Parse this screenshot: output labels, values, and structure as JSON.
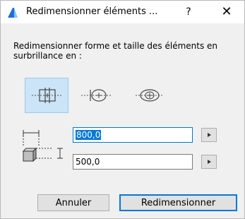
{
  "window": {
    "title": "Redimensionner éléments ...",
    "help_label": "?",
    "close_label": "✕"
  },
  "prompt": "Redimensionner forme et taille des éléments en surbrillance en :",
  "modes": [
    {
      "name": "resize-mode-rectangle",
      "selected": true
    },
    {
      "name": "resize-mode-ellipse-horizontal",
      "selected": false
    },
    {
      "name": "resize-mode-ellipse-offset",
      "selected": false
    }
  ],
  "width_field": {
    "value": "800,0"
  },
  "height_field": {
    "value": "500,0"
  },
  "buttons": {
    "cancel": "Annuler",
    "ok": "Redimensionner"
  },
  "colors": {
    "selection": "#0078d7",
    "selected_mode_bg": "#cce4f7",
    "app_icon": "#1e6fd9"
  },
  "icons": {
    "app": "archicad-icon",
    "arrow": "play-arrow-icon",
    "dimensions": "box-dimensions-icon"
  }
}
